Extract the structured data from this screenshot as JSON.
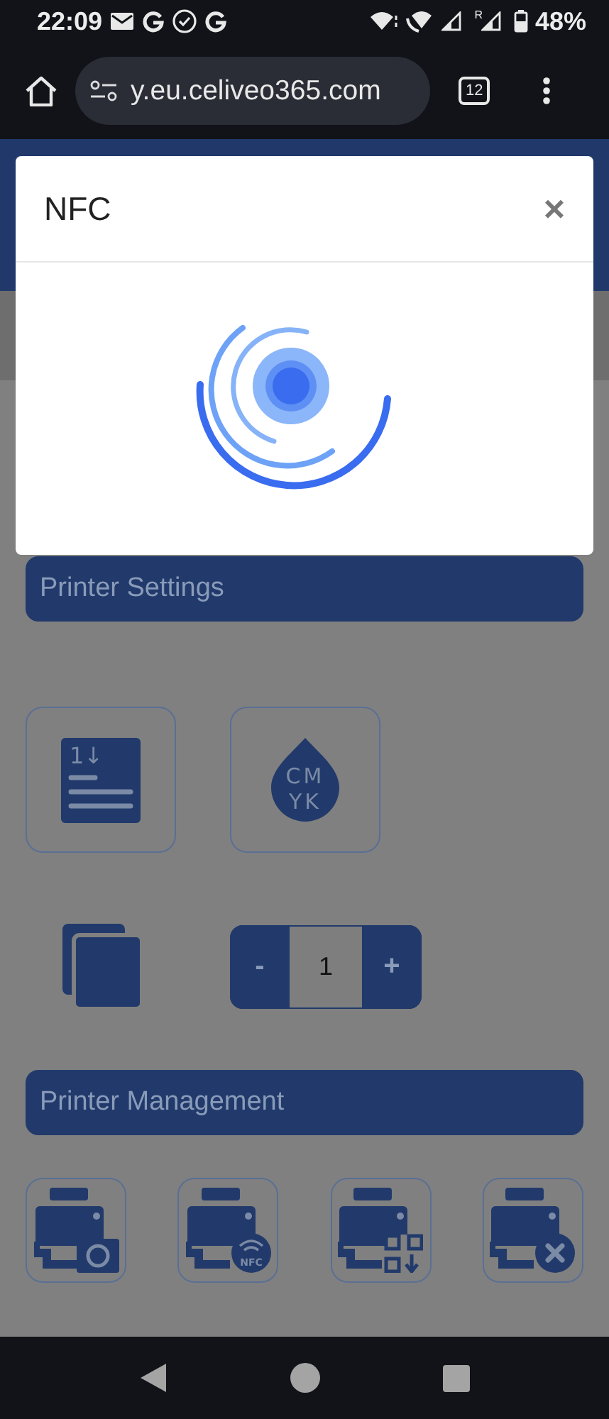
{
  "status_bar": {
    "time": "22:09",
    "roaming": "R",
    "battery": "48%"
  },
  "browser": {
    "url": "y.eu.celiveo365.com",
    "tab_count": "12"
  },
  "modal": {
    "title": "NFC",
    "close": "×"
  },
  "settings": {
    "title": "Printer Settings",
    "tiles": [
      {
        "kind": "sort",
        "label": "1↓"
      },
      {
        "kind": "cmyk",
        "label": "CM",
        "label_2": "YK"
      }
    ],
    "copies": {
      "minus": "-",
      "value": "1",
      "plus": "+"
    }
  },
  "management": {
    "title": "Printer Management",
    "tiles": [
      {
        "kind": "camera"
      },
      {
        "kind": "nfc",
        "badge": "NFC"
      },
      {
        "kind": "qr"
      },
      {
        "kind": "remove"
      }
    ]
  }
}
